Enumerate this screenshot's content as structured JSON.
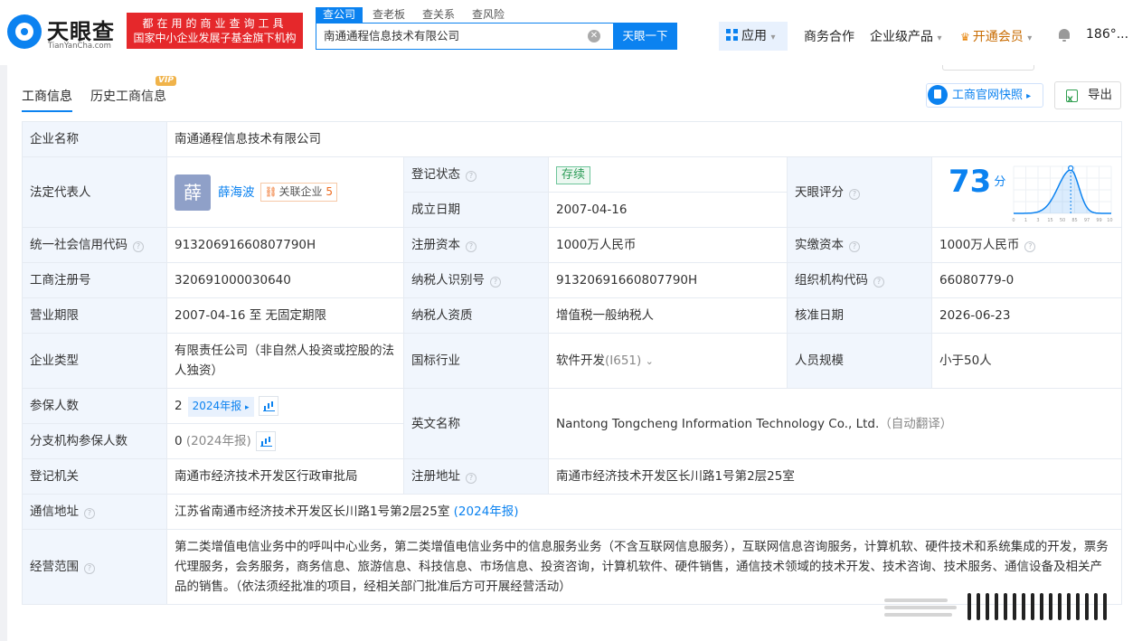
{
  "brand": {
    "name": "天眼查",
    "domain": "TianYanCha.com",
    "slogan_1": "都在用的商业查询工具",
    "slogan_2": "国家中小企业发展子基金旗下机构"
  },
  "search": {
    "tabs": [
      "查公司",
      "查老板",
      "查关系",
      "查风险"
    ],
    "value": "南通通程信息技术有限公司",
    "button": "天眼一下"
  },
  "nav": {
    "apps": "应用",
    "business": "商务合作",
    "enterprise": "企业级产品",
    "vip": "开通会员",
    "user": "186°..."
  },
  "tabs": {
    "basic": "工商信息",
    "history": "历史工商信息",
    "vip": "VIP"
  },
  "actions": {
    "snapshot": "工商官网快照",
    "export": "导出"
  },
  "info": {
    "company_name_label": "企业名称",
    "company_name": "南通通程信息技术有限公司",
    "legal_rep_label": "法定代表人",
    "legal_rep_avatar": "薛",
    "legal_rep": "薛海波",
    "related_label": "关联企业",
    "related_count": "5",
    "reg_status_label": "登记状态",
    "reg_status": "存续",
    "found_date_label": "成立日期",
    "found_date": "2007-04-16",
    "score_label": "天眼评分",
    "score": "73",
    "score_unit": "分",
    "credit_code_label": "统一社会信用代码",
    "credit_code": "91320691660807790H",
    "reg_capital_label": "注册资本",
    "reg_capital": "1000万人民币",
    "paid_capital_label": "实缴资本",
    "paid_capital": "1000万人民币",
    "reg_no_label": "工商注册号",
    "reg_no": "320691000030640",
    "taxpayer_id_label": "纳税人识别号",
    "taxpayer_id": "91320691660807790H",
    "org_code_label": "组织机构代码",
    "org_code": "66080779-0",
    "term_label": "营业期限",
    "term": "2007-04-16 至 无固定期限",
    "taxpayer_type_label": "纳税人资质",
    "taxpayer_type": "增值税一般纳税人",
    "approval_date_label": "核准日期",
    "approval_date": "2026-06-23",
    "company_type_label": "企业类型",
    "company_type": "有限责任公司（非自然人投资或控股的法人独资）",
    "industry_label": "国标行业",
    "industry": "软件开发",
    "industry_code": "(I651)",
    "staff_size_label": "人员规模",
    "staff_size": "小于50人",
    "insured_label": "参保人数",
    "insured": "2",
    "insured_year": "2024年报",
    "branch_insured_label": "分支机构参保人数",
    "branch_insured": "0",
    "branch_insured_year": "(2024年报)",
    "english_name_label": "英文名称",
    "english_name": "Nantong Tongcheng Information Technology Co., Ltd.",
    "english_note": "（自动翻译）",
    "authority_label": "登记机关",
    "authority": "南通市经济技术开发区行政审批局",
    "reg_address_label": "注册地址",
    "reg_address": "南通市经济技术开发区长川路1号第2层25室",
    "mail_address_label": "通信地址",
    "mail_address": "江苏省南通市经济技术开发区长川路1号第2层25室",
    "mail_address_year": "(2024年报)",
    "scope_label": "经营范围",
    "scope": "第二类增值电信业务中的呼叫中心业务，第二类增值电信业务中的信息服务业务（不含互联网信息服务），互联网信息咨询服务，计算机软、硬件技术和系统集成的开发，票务代理服务，会务服务，商务信息、旅游信息、科技信息、市场信息、投资咨询，计算机软件、硬件销售，通信技术领域的技术开发、技术咨询、技术服务、通信设备及相关产品的销售。（依法须经批准的项目，经相关部门批准后方可开展经营活动）"
  },
  "score_chart": {
    "ticks": [
      "0",
      "1",
      "3",
      "15",
      "50",
      "85",
      "97",
      "99",
      "100"
    ],
    "marker_value": 73,
    "color": "#0b82f0"
  }
}
